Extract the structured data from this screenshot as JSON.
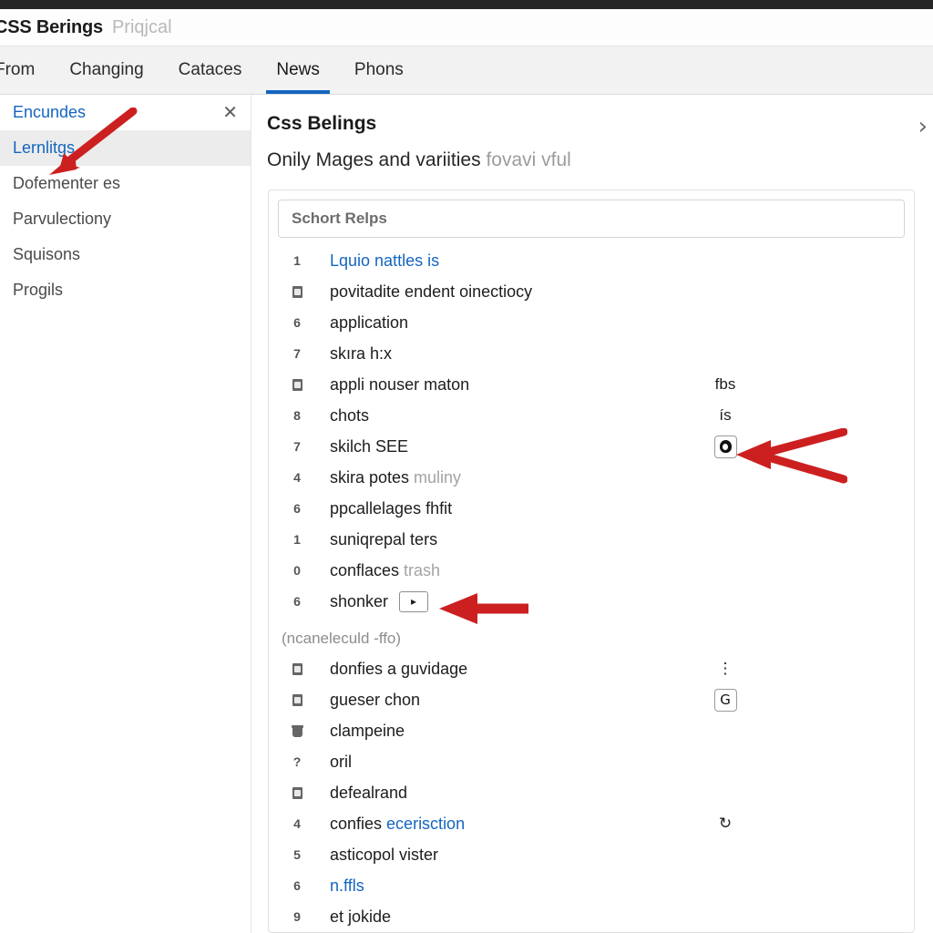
{
  "window": {
    "title_main": "CSS Berings",
    "title_sub": "Priqjcal"
  },
  "tabs": [
    {
      "label": "From",
      "active": false
    },
    {
      "label": "Changing",
      "active": false
    },
    {
      "label": "Cataces",
      "active": false
    },
    {
      "label": "News",
      "active": true
    },
    {
      "label": "Phons",
      "active": false
    }
  ],
  "sidebar": {
    "header_label": "Encundes",
    "close_icon": "close-icon",
    "items": [
      {
        "label": "Lernlitgs",
        "selected": true
      },
      {
        "label": "Dofementer es",
        "selected": false
      },
      {
        "label": "Parvulectiony",
        "selected": false
      },
      {
        "label": "Squisons",
        "selected": false
      },
      {
        "label": "Progils",
        "selected": false
      }
    ]
  },
  "content": {
    "title": "Css Belings",
    "subtitle_strong": "Onily Mages and variities",
    "subtitle_muted": "fovavi vful",
    "chevron_icon": "chevron-right-icon",
    "search": {
      "placeholder": "Schort Relps",
      "value": ""
    },
    "group_label": "(ncaneleculd -ffo)",
    "rows_group1": [
      {
        "marker": "1",
        "marker_kind": "digit",
        "text": "Lquio nattles is",
        "style": "link",
        "trailing": "",
        "trailing_kind": "none"
      },
      {
        "marker": "",
        "marker_kind": "box",
        "text": "povitadite endent oinectiocy",
        "style": "plain",
        "trailing": "",
        "trailing_kind": "none"
      },
      {
        "marker": "6",
        "marker_kind": "digit",
        "text": "application",
        "style": "plain",
        "trailing": "",
        "trailing_kind": "none"
      },
      {
        "marker": "7",
        "marker_kind": "digit",
        "text": "skıra h:x",
        "style": "plain",
        "trailing": "",
        "trailing_kind": "none"
      },
      {
        "marker": "",
        "marker_kind": "box",
        "text": "appli nouser maton",
        "style": "plain",
        "trailing": "fbs",
        "trailing_kind": "text"
      },
      {
        "marker": "8",
        "marker_kind": "digit",
        "text": "chots",
        "style": "plain",
        "trailing": "ís",
        "trailing_kind": "text"
      },
      {
        "marker": "7",
        "marker_kind": "digit",
        "text": "skilch SEE",
        "style": "plain",
        "trailing": "blob",
        "trailing_kind": "chip-blob"
      },
      {
        "marker": "4",
        "marker_kind": "digit",
        "text": "skira potes ",
        "text_dim": "muliny",
        "style": "plain-dim",
        "trailing": "",
        "trailing_kind": "none"
      },
      {
        "marker": "6",
        "marker_kind": "digit",
        "text": "ppcallelages fhfit",
        "style": "plain",
        "trailing": "",
        "trailing_kind": "none"
      },
      {
        "marker": "1",
        "marker_kind": "digit",
        "text": "suniqrepal ters",
        "style": "plain",
        "trailing": "",
        "trailing_kind": "none"
      },
      {
        "marker": "0",
        "marker_kind": "digit",
        "text": "conflaces ",
        "text_dim": "trash",
        "style": "plain-dim",
        "trailing": "",
        "trailing_kind": "none"
      },
      {
        "marker": "6",
        "marker_kind": "digit",
        "text": "shonker",
        "style": "plain",
        "inline_button": "▸",
        "trailing": "",
        "trailing_kind": "none"
      }
    ],
    "rows_group2": [
      {
        "marker": "",
        "marker_kind": "box",
        "text": "donfies a guvidage",
        "style": "plain",
        "trailing": "⋮",
        "trailing_kind": "text"
      },
      {
        "marker": "",
        "marker_kind": "box",
        "text": "gueser chon",
        "style": "plain",
        "trailing": "G",
        "trailing_kind": "chip-text"
      },
      {
        "marker": "",
        "marker_kind": "cup",
        "text": "clampeine",
        "style": "plain",
        "trailing": "",
        "trailing_kind": "none"
      },
      {
        "marker": "?",
        "marker_kind": "digit",
        "text": "oril",
        "style": "plain",
        "trailing": "",
        "trailing_kind": "none"
      },
      {
        "marker": "",
        "marker_kind": "box",
        "text": "defealrand",
        "style": "plain",
        "trailing": "",
        "trailing_kind": "none"
      },
      {
        "marker": "4",
        "marker_kind": "digit",
        "text": "confies ",
        "text_link": "ecerisction",
        "style": "plain-link",
        "trailing": "↻",
        "trailing_kind": "text"
      },
      {
        "marker": "5",
        "marker_kind": "digit",
        "text": "asticopol vister",
        "style": "plain",
        "trailing": "",
        "trailing_kind": "none"
      },
      {
        "marker": "6",
        "marker_kind": "digit",
        "text": "n.ffls",
        "style": "link",
        "trailing": "",
        "trailing_kind": "none"
      },
      {
        "marker": "9",
        "marker_kind": "digit",
        "text": "et jokide",
        "style": "plain",
        "trailing": "",
        "trailing_kind": "none"
      }
    ]
  },
  "annotations": {
    "arrow_color": "#cc2020",
    "arrows": [
      {
        "name": "arrow-to-sidebar-selected"
      },
      {
        "name": "arrow-to-chip-blob"
      },
      {
        "name": "arrow-to-inline-button"
      }
    ]
  }
}
